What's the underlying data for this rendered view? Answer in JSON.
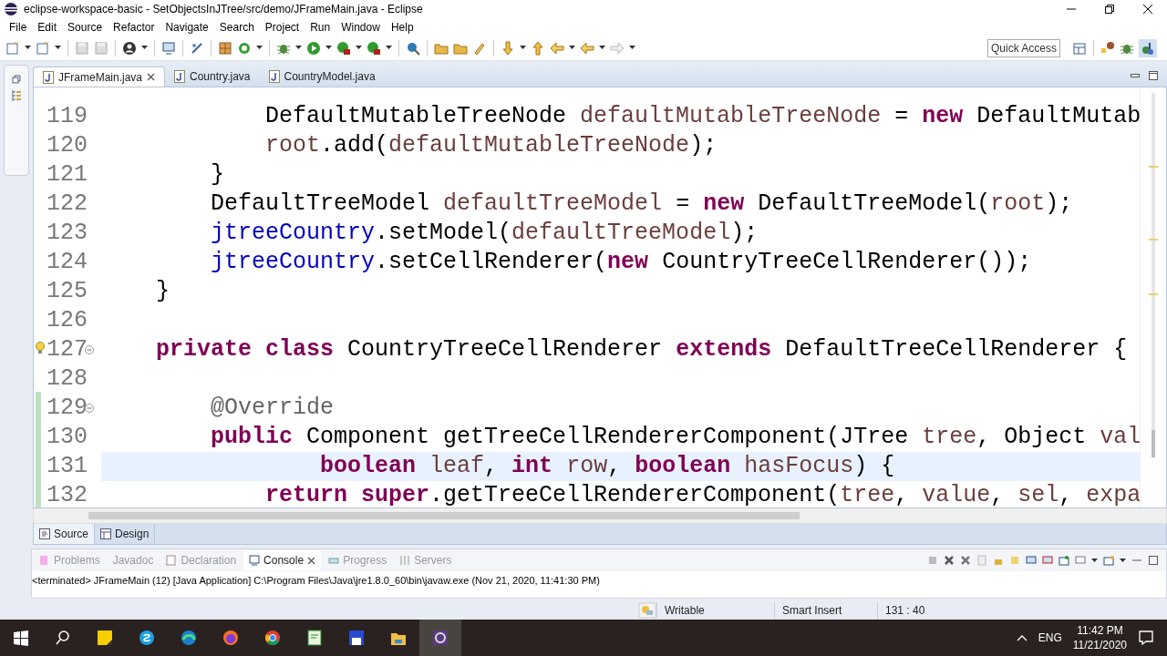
{
  "window": {
    "title": "eclipse-workspace-basic - SetObjectsInJTree/src/demo/JFrameMain.java - Eclipse"
  },
  "menu": [
    {
      "label": "File"
    },
    {
      "label": "Edit"
    },
    {
      "label": "Source"
    },
    {
      "label": "Refactor"
    },
    {
      "label": "Navigate"
    },
    {
      "label": "Search"
    },
    {
      "label": "Project"
    },
    {
      "label": "Run"
    },
    {
      "label": "Window"
    },
    {
      "label": "Help"
    }
  ],
  "toolbar": {
    "quick_access": "Quick Access"
  },
  "editor_tabs": [
    {
      "label": "JFrameMain.java",
      "selected": true
    },
    {
      "label": "Country.java",
      "selected": false
    },
    {
      "label": "CountryModel.java",
      "selected": false
    }
  ],
  "code": {
    "lines": [
      {
        "number": "119",
        "current": false,
        "fold": false,
        "warning": false,
        "changed": false,
        "tokens": [
          {
            "kind": "plain",
            "text": "            DefaultMutableTreeNode "
          },
          {
            "kind": "var",
            "text": "defaultMutableTreeNode"
          },
          {
            "kind": "plain",
            "text": " = "
          },
          {
            "kind": "keyword",
            "text": "new"
          },
          {
            "kind": "plain",
            "text": " DefaultMutab"
          }
        ]
      },
      {
        "number": "120",
        "current": false,
        "fold": false,
        "warning": false,
        "changed": false,
        "tokens": [
          {
            "kind": "var",
            "text": "            root"
          },
          {
            "kind": "plain",
            "text": ".add("
          },
          {
            "kind": "var",
            "text": "defaultMutableTreeNode"
          },
          {
            "kind": "plain",
            "text": ");"
          }
        ]
      },
      {
        "number": "121",
        "current": false,
        "fold": false,
        "warning": false,
        "changed": false,
        "tokens": [
          {
            "kind": "plain",
            "text": "        }"
          }
        ]
      },
      {
        "number": "122",
        "current": false,
        "fold": false,
        "warning": false,
        "changed": false,
        "tokens": [
          {
            "kind": "plain",
            "text": "        DefaultTreeModel "
          },
          {
            "kind": "var",
            "text": "defaultTreeModel"
          },
          {
            "kind": "plain",
            "text": " = "
          },
          {
            "kind": "keyword",
            "text": "new"
          },
          {
            "kind": "plain",
            "text": " DefaultTreeModel("
          },
          {
            "kind": "var",
            "text": "root"
          },
          {
            "kind": "plain",
            "text": ");"
          }
        ]
      },
      {
        "number": "123",
        "current": false,
        "fold": false,
        "warning": false,
        "changed": false,
        "tokens": [
          {
            "kind": "field",
            "text": "        jtreeCountry"
          },
          {
            "kind": "plain",
            "text": ".setModel("
          },
          {
            "kind": "var",
            "text": "defaultTreeModel"
          },
          {
            "kind": "plain",
            "text": ");"
          }
        ]
      },
      {
        "number": "124",
        "current": false,
        "fold": false,
        "warning": false,
        "changed": false,
        "tokens": [
          {
            "kind": "field",
            "text": "        jtreeCountry"
          },
          {
            "kind": "plain",
            "text": ".setCellRenderer("
          },
          {
            "kind": "keyword",
            "text": "new"
          },
          {
            "kind": "plain",
            "text": " CountryTreeCellRenderer());"
          }
        ]
      },
      {
        "number": "125",
        "current": false,
        "fold": false,
        "warning": false,
        "changed": false,
        "tokens": [
          {
            "kind": "plain",
            "text": "    }"
          }
        ]
      },
      {
        "number": "126",
        "current": false,
        "fold": false,
        "warning": false,
        "changed": false
      },
      {
        "number": "127",
        "current": false,
        "fold": true,
        "warning": true,
        "changed": false,
        "tokens": [
          {
            "kind": "keyword",
            "text": "    private class"
          },
          {
            "kind": "plain",
            "text": " CountryTreeCellRenderer "
          },
          {
            "kind": "keyword",
            "text": "extends"
          },
          {
            "kind": "plain",
            "text": " DefaultTreeCellRenderer {"
          }
        ]
      },
      {
        "number": "128",
        "current": false,
        "fold": false,
        "warning": false,
        "changed": false
      },
      {
        "number": "129",
        "current": false,
        "fold": true,
        "warning": false,
        "changed": true,
        "tokens": [
          {
            "kind": "annotation",
            "text": "        @Override"
          }
        ]
      },
      {
        "number": "130",
        "current": false,
        "fold": false,
        "warning": false,
        "changed": true,
        "tokens": [
          {
            "kind": "keyword",
            "text": "        public"
          },
          {
            "kind": "plain",
            "text": " Component getTreeCellRendererComponent(JTree "
          },
          {
            "kind": "var",
            "text": "tree"
          },
          {
            "kind": "plain",
            "text": ", Object "
          },
          {
            "kind": "var",
            "text": "val"
          }
        ]
      },
      {
        "number": "131",
        "current": true,
        "fold": false,
        "warning": false,
        "changed": true,
        "tokens": [
          {
            "kind": "keyword",
            "text": "                boolean"
          },
          {
            "kind": "var",
            "text": " leaf"
          },
          {
            "kind": "plain",
            "text": ", "
          },
          {
            "kind": "keyword",
            "text": "int"
          },
          {
            "kind": "var",
            "text": " row"
          },
          {
            "kind": "plain",
            "text": ", "
          },
          {
            "kind": "keyword",
            "text": "boolean"
          },
          {
            "kind": "var",
            "text": " hasFocus"
          },
          {
            "kind": "plain",
            "text": ") {"
          }
        ]
      },
      {
        "number": "132",
        "current": false,
        "fold": false,
        "warning": false,
        "changed": true,
        "tokens": [
          {
            "kind": "keyword",
            "text": "            return super"
          },
          {
            "kind": "plain",
            "text": ".getTreeCellRendererComponent("
          },
          {
            "kind": "var",
            "text": "tree"
          },
          {
            "kind": "plain",
            "text": ", "
          },
          {
            "kind": "var",
            "text": "value"
          },
          {
            "kind": "plain",
            "text": ", "
          },
          {
            "kind": "var",
            "text": "sel"
          },
          {
            "kind": "plain",
            "text": ", "
          },
          {
            "kind": "var",
            "text": "expa"
          }
        ]
      }
    ]
  },
  "editor_modes": [
    {
      "label": "Source",
      "selected": true
    },
    {
      "label": "Design",
      "selected": false
    }
  ],
  "console": {
    "tabs": [
      {
        "label": "Problems",
        "selected": false
      },
      {
        "label": "Javadoc",
        "selected": false
      },
      {
        "label": "Declaration",
        "selected": false
      },
      {
        "label": "Console",
        "selected": true
      },
      {
        "label": "Progress",
        "selected": false
      },
      {
        "label": "Servers",
        "selected": false
      }
    ],
    "text": "<terminated> JFrameMain (12) [Java Application] C:\\Program Files\\Java\\jre1.8.0_60\\bin\\javaw.exe (Nov 21, 2020, 11:41:30 PM)"
  },
  "status_bar": {
    "mode": "Writable",
    "insert": "Smart Insert",
    "position": "131 : 40"
  },
  "taskbar": {
    "language": "ENG",
    "time": "11:42 PM",
    "date": "11/21/2020"
  }
}
